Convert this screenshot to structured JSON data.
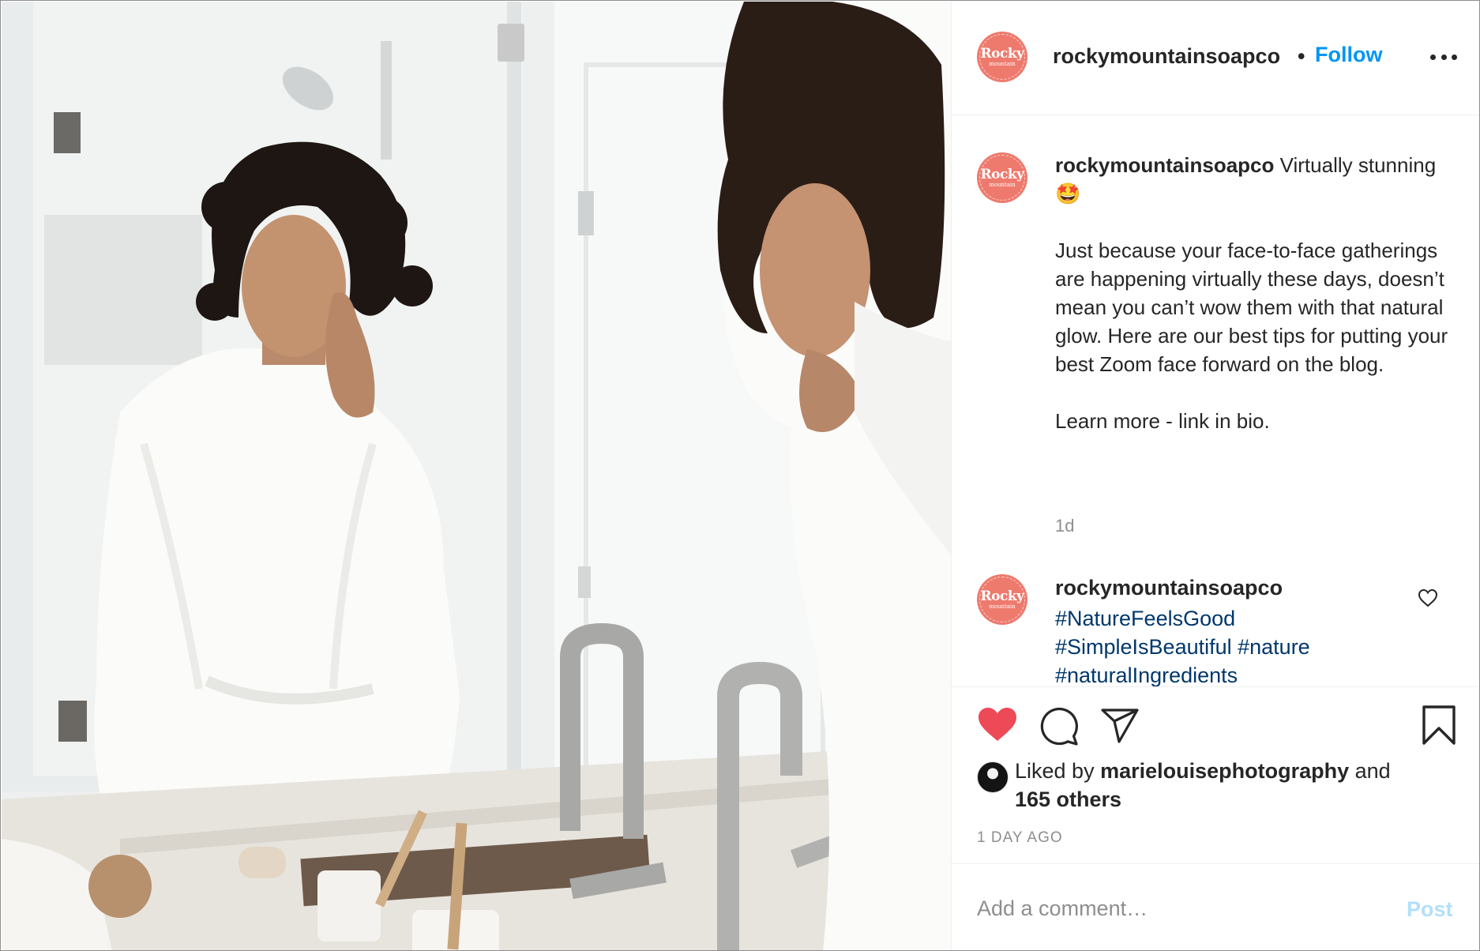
{
  "post": {
    "username": "rockymountainsoapco",
    "separator": "•",
    "follow_label": "Follow",
    "avatar": {
      "line1": "Rocky",
      "line2": "mountain",
      "line3": "soap co"
    }
  },
  "caption": {
    "username": "rockymountainsoapco",
    "text": " Virtually stunning 🤩\n\nJust because your face-to-face gatherings are happening virtually these days, doesn’t mean you can’t wow them with that natural glow. Here are our best tips for putting your best Zoom face forward on the blog.\n\nLearn more - link in bio.",
    "time": "1d"
  },
  "comment": {
    "username": "rockymountainsoapco",
    "text": "#NatureFeelsGood #SimpleIsBeautiful #nature #naturalIngredients"
  },
  "likes": {
    "prefix": "Liked by ",
    "liker": "marielouisephotography",
    "middle": " and",
    "others": "165 others"
  },
  "timestamp": "1 DAY AGO",
  "add_comment": {
    "placeholder": "Add a comment…",
    "post_label": "Post"
  },
  "colors": {
    "accent": "#0095f6",
    "like": "#ed4956",
    "brand": "#ee7a6e",
    "hashtag": "#00376b"
  },
  "icons": [
    "more-icon",
    "heart-icon",
    "comment-icon",
    "share-icon",
    "save-icon",
    "small-heart-icon"
  ]
}
